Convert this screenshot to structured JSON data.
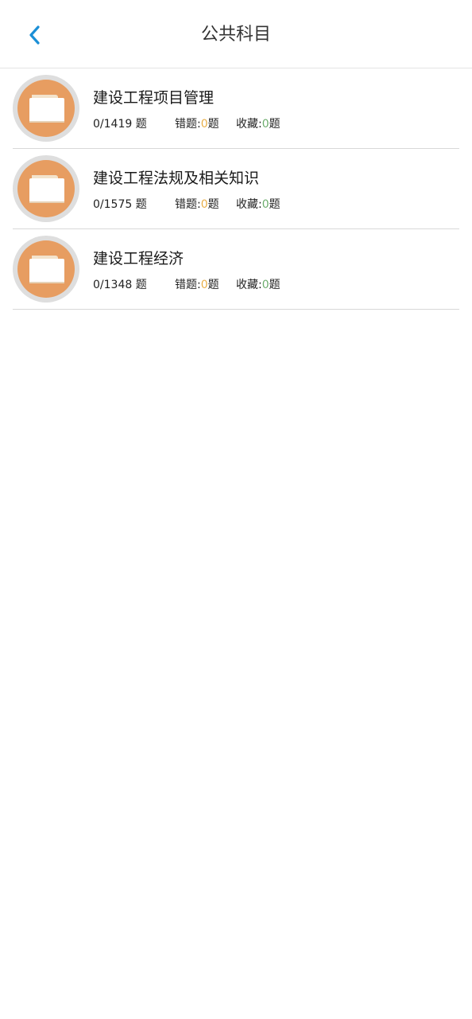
{
  "header": {
    "title": "公共科目",
    "back_icon": "chevron-left-icon",
    "accent_color": "#1b8fd6"
  },
  "subjects": [
    {
      "name": "建设工程项目管理",
      "progress": "0/1419 题",
      "wrong_label": "错题:",
      "wrong_count": "0",
      "wrong_unit": "题",
      "fav_label": "收藏:",
      "fav_count": "0",
      "fav_unit": "题"
    },
    {
      "name": "建设工程法规及相关知识",
      "progress": "0/1575 题",
      "wrong_label": "错题:",
      "wrong_count": "0",
      "wrong_unit": "题",
      "fav_label": "收藏:",
      "fav_count": "0",
      "fav_unit": "题"
    },
    {
      "name": "建设工程经济",
      "progress": "0/1348 题",
      "wrong_label": "错题:",
      "wrong_count": "0",
      "wrong_unit": "题",
      "fav_label": "收藏:",
      "fav_count": "0",
      "fav_unit": "题"
    }
  ],
  "colors": {
    "folder_circle": "#e79d61",
    "wrong_count": "#e9b04a",
    "fav_count": "#6fae6f"
  }
}
